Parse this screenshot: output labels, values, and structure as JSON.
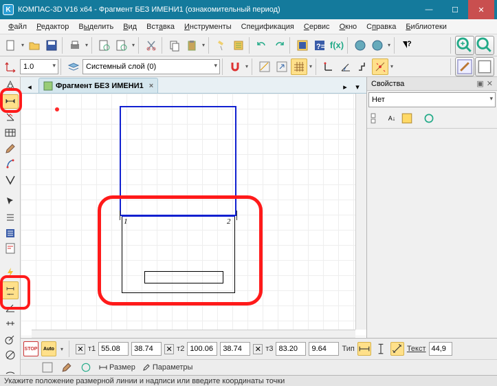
{
  "titlebar": {
    "app_icon": "K",
    "title": "КОМПАС-3D V16  x64 - Фрагмент БЕЗ ИМЕНИ1 (ознакомительный период)"
  },
  "menu": {
    "file": "Файл",
    "edit": "Редактор",
    "select": "Выделить",
    "view": "Вид",
    "insert": "Вставка",
    "tools": "Инструменты",
    "spec": "Спецификация",
    "service": "Сервис",
    "window": "Окно",
    "help": "Справка",
    "libs": "Библиотеки"
  },
  "toolbar2": {
    "scale": "1.0",
    "layer_label": "Системный слой (0)"
  },
  "doc_tab": {
    "label": "Фрагмент БЕЗ ИМЕНИ1",
    "close": "×"
  },
  "canvas": {
    "dim1": "1",
    "dim2": "2"
  },
  "props": {
    "title": "Свойства",
    "pin": "✕",
    "filter": "Нет"
  },
  "bottom": {
    "t1_lbl": "т1",
    "t1_x": "55.08",
    "t1_y": "38.74",
    "t2_lbl": "т2",
    "t2_x": "100.06",
    "t2_y": "38.74",
    "t3_lbl": "т3",
    "t3_x": "83.20",
    "t3_y": "9.64",
    "type_lbl": "Тип",
    "text_lbl": "Текст",
    "text_val": "44,9",
    "tab_size": "Размер",
    "tab_params": "Параметры"
  },
  "status": {
    "msg": "Укажите положение размерной линии и надписи или введите координаты точки"
  }
}
